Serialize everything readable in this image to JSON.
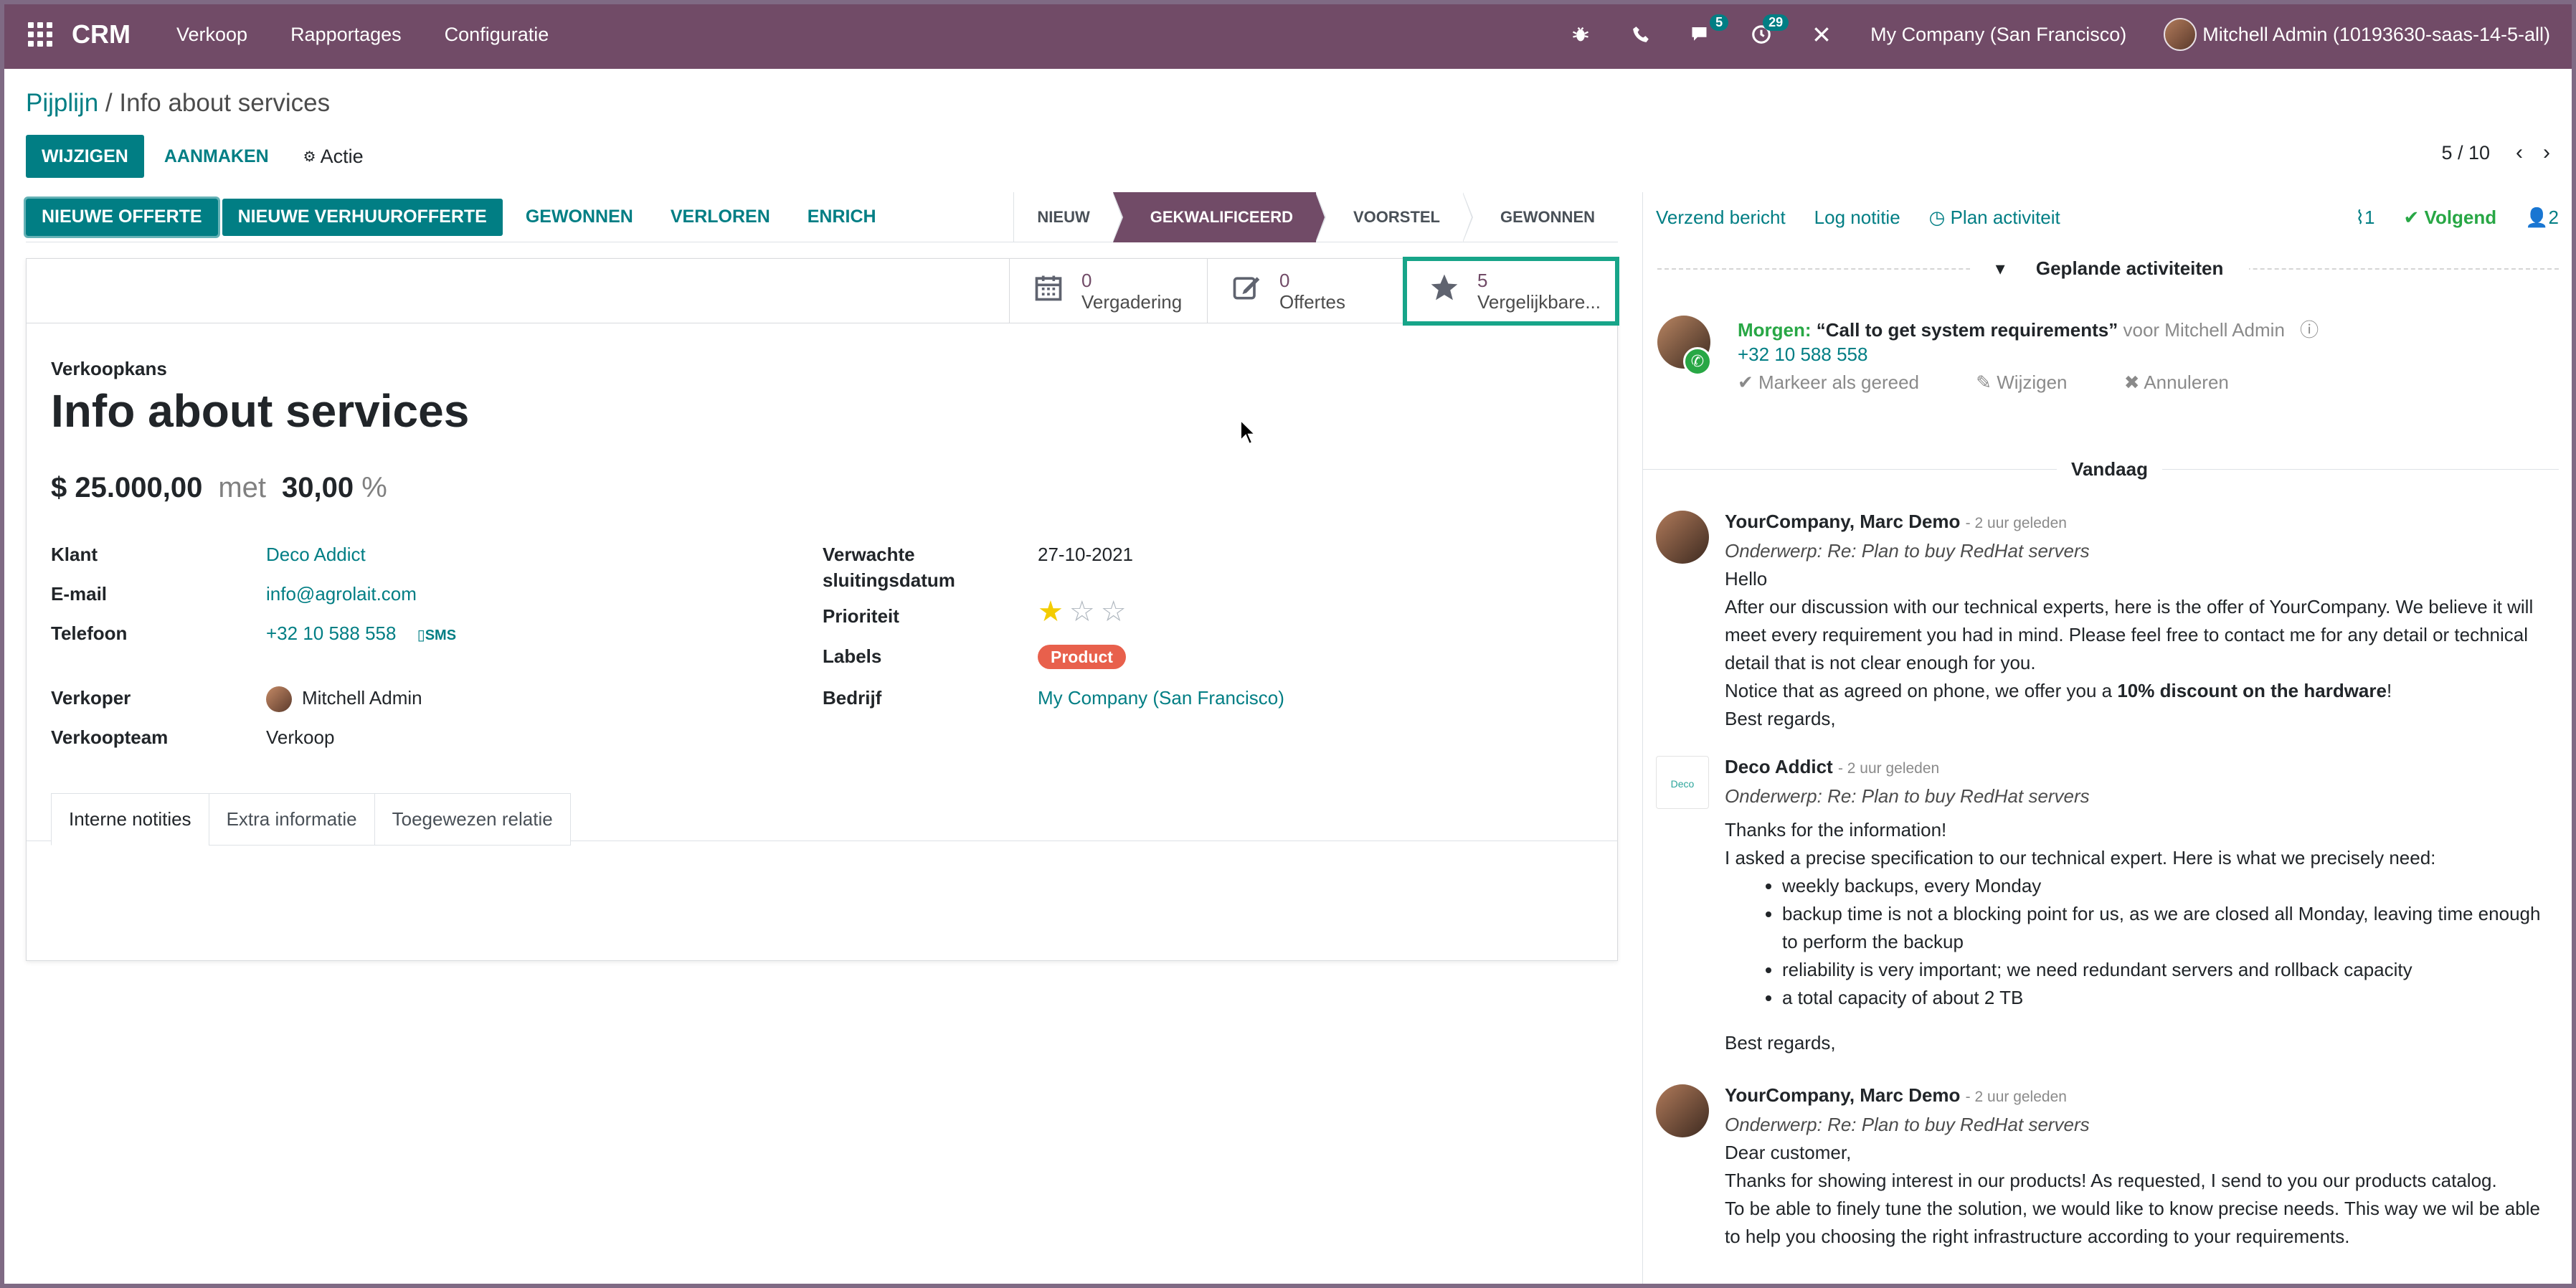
{
  "navbar": {
    "brand": "CRM",
    "menu": [
      "Verkoop",
      "Rapportages",
      "Configuratie"
    ],
    "messages_badge": "5",
    "activities_badge": "29",
    "company": "My Company (San Francisco)",
    "user": "Mitchell Admin (10193630-saas-14-5-all)",
    "bg_color": "#714b67"
  },
  "breadcrumb": {
    "parent": "Pijplijn",
    "separator": " / ",
    "current": "Info about services"
  },
  "control_panel": {
    "edit_label": "WIJZIGEN",
    "create_label": "AANMAKEN",
    "action_label": "Actie",
    "pager": "5 / 10"
  },
  "statusbar": {
    "buttons": [
      "NIEUWE OFFERTE",
      "NIEUWE VERHUUROFFERTE",
      "GEWONNEN",
      "VERLOREN",
      "ENRICH"
    ],
    "stages": [
      "NIEUW",
      "GEKWALIFICEERD",
      "VOORSTEL",
      "GEWONNEN"
    ],
    "active_stage": "GEKWALIFICEERD"
  },
  "smart_buttons": [
    {
      "icon": "calendar-icon",
      "count": "0",
      "label": "Vergadering"
    },
    {
      "icon": "pencil-square-icon",
      "count": "0",
      "label": "Offertes"
    },
    {
      "icon": "star-icon",
      "count": "5",
      "label": "Vergelijkbare..."
    }
  ],
  "form": {
    "label": "Verkoopkans",
    "title": "Info about services",
    "revenue": "$ 25.000,00",
    "met": "met",
    "probability": "30,00",
    "percent": "%",
    "left_fields": {
      "klant_label": "Klant",
      "klant_value": "Deco Addict",
      "email_label": "E-mail",
      "email_value": "info@agrolait.com",
      "telefoon_label": "Telefoon",
      "telefoon_value": "+32 10 588 558",
      "sms_label": "SMS",
      "verkoper_label": "Verkoper",
      "verkoper_value": "Mitchell Admin",
      "team_label": "Verkoopteam",
      "team_value": "Verkoop"
    },
    "right_fields": {
      "datum_label_1": "Verwachte",
      "datum_label_2": "sluitingsdatum",
      "datum_value": "27-10-2021",
      "prioriteit_label": "Prioriteit",
      "prioriteit_stars": 1,
      "labels_label": "Labels",
      "labels_tag": "Product",
      "bedrijf_label": "Bedrijf",
      "bedrijf_value": "My Company (San Francisco)"
    },
    "tabs": [
      "Interne notities",
      "Extra informatie",
      "Toegewezen relatie"
    ]
  },
  "chatter": {
    "send_message": "Verzend bericht",
    "log_note": "Log notitie",
    "plan_activity": "Plan activiteit",
    "attachments": "1",
    "following": "Volgend",
    "followers": "2",
    "planned_title": "Geplande activiteiten",
    "activity": {
      "when": "Morgen:",
      "summary": "“Call to get system requirements”",
      "for": "voor Mitchell Admin",
      "phone": "+32 10 588 558",
      "mark_done": "Markeer als gereed",
      "edit": "Wijzigen",
      "cancel": "Annuleren"
    },
    "today": "Vandaag",
    "messages": [
      {
        "author": "YourCompany, Marc Demo",
        "time": "- 2 uur geleden",
        "subject": "Onderwerp: Re: Plan to buy RedHat servers",
        "hello": "Hello",
        "body1": "After our discussion with our technical experts, here is the offer of YourCompany. We believe it will meet every requirement you had in mind. Please feel free to contact me for any detail or technical detail that is not clear enough for you.",
        "notice_pre": "Notice that as agreed on phone, we offer you a ",
        "notice_bold": "10% discount on the hardware",
        "notice_post": "!",
        "regards": "Best regards,"
      },
      {
        "author": "Deco Addict",
        "logo_text": "Deco",
        "time": "- 2 uur geleden",
        "subject": "Onderwerp: Re: Plan to buy RedHat servers",
        "thanks": "Thanks for the information!",
        "intro": "I asked a precise specification to our technical expert. Here is what we precisely need:",
        "items": [
          "weekly backups, every Monday",
          "backup time is not a blocking point for us, as we are closed all Monday, leaving time enough to perform the backup",
          "reliability is very important; we need redundant servers and rollback capacity",
          "a total capacity of about 2 TB"
        ],
        "regards": "Best regards,"
      },
      {
        "author": "YourCompany, Marc Demo",
        "time": "- 2 uur geleden",
        "subject": "Onderwerp: Re: Plan to buy RedHat servers",
        "greeting": "Dear customer,",
        "body1": "Thanks for showing interest in our products! As requested, I send to you our products catalog.",
        "body2": "To be able to finely tune the solution, we would like to know precise needs. This way we wil be able to help you choosing the right infrastructure according to your requirements."
      }
    ]
  }
}
